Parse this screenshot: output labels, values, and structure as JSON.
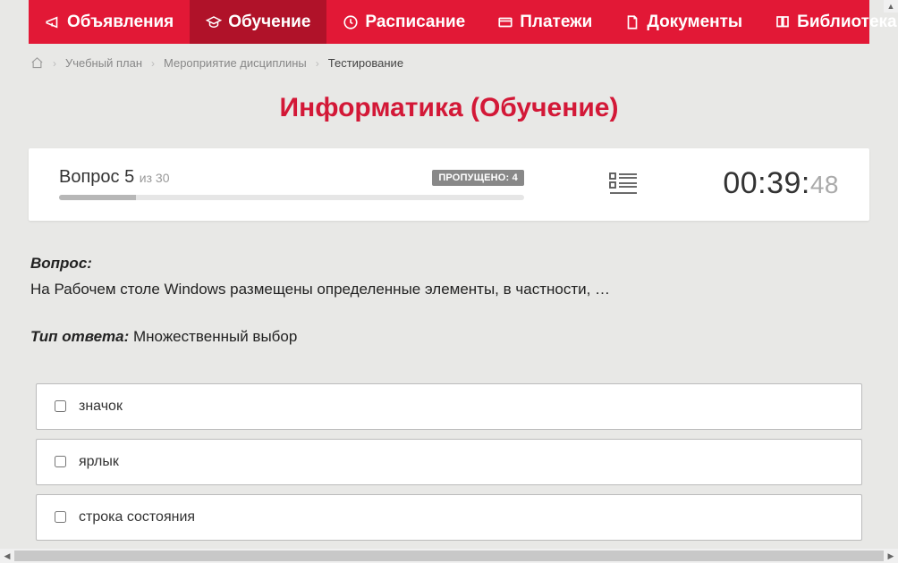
{
  "nav": {
    "items": [
      {
        "label": "Объявления",
        "icon": "megaphone",
        "active": false
      },
      {
        "label": "Обучение",
        "icon": "education",
        "active": true
      },
      {
        "label": "Расписание",
        "icon": "clock",
        "active": false
      },
      {
        "label": "Платежи",
        "icon": "payment",
        "active": false
      },
      {
        "label": "Документы",
        "icon": "document",
        "active": false
      },
      {
        "label": "Библиотека",
        "icon": "book",
        "active": false,
        "dropdown": true
      }
    ]
  },
  "breadcrumb": {
    "items": [
      {
        "label": "Учебный план"
      },
      {
        "label": "Мероприятие дисциплины"
      }
    ],
    "current": "Тестирование"
  },
  "page": {
    "title": "Информатика (Обучение)"
  },
  "status": {
    "question_label": "Вопрос 5",
    "of_label": "из 30",
    "skipped_label": "ПРОПУЩЕНО: 4",
    "progress_percent": 16.6,
    "timer_main": "00:39:",
    "timer_ms": "48"
  },
  "question": {
    "prompt_label": "Вопрос:",
    "text": "На Рабочем столе Windows размещены определенные элементы, в частности, …",
    "answer_type_label": "Тип ответа:",
    "answer_type_value": "Множественный выбор",
    "options": [
      {
        "text": "значок"
      },
      {
        "text": "ярлык"
      },
      {
        "text": "строка состояния"
      }
    ]
  }
}
